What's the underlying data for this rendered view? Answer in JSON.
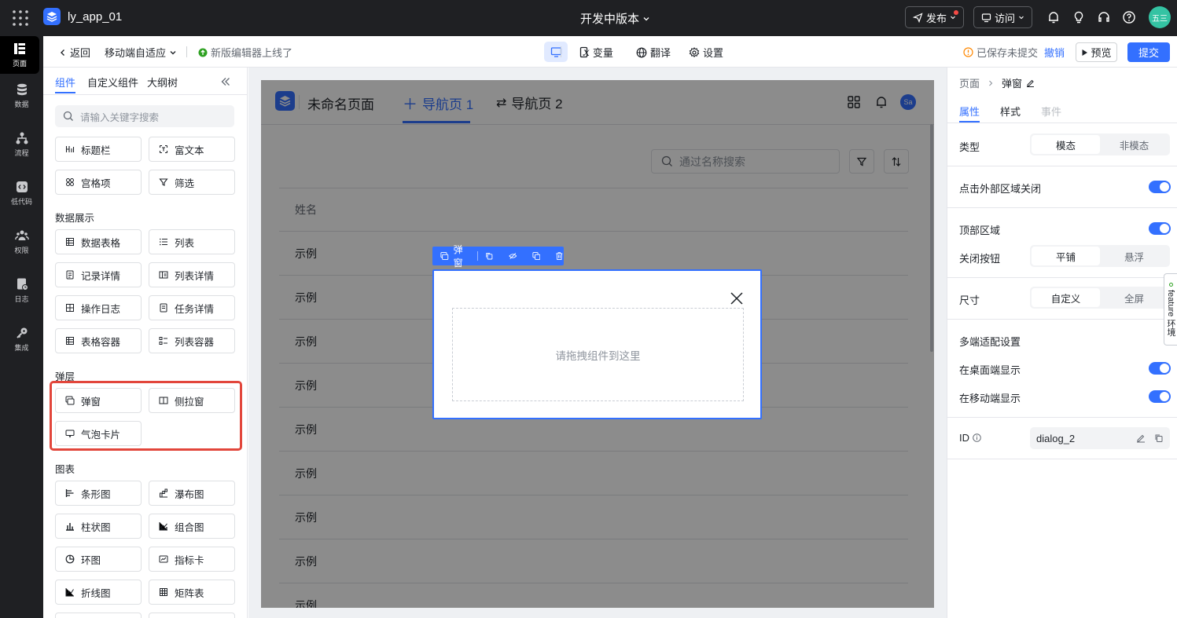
{
  "topbar": {
    "app_name": "ly_app_01",
    "center_title": "开发中版本",
    "publish_label": "发布",
    "visit_label": "访问",
    "avatar_text": "五三"
  },
  "leftnav": {
    "items": [
      {
        "label": "页面",
        "icon": "page-icon"
      },
      {
        "label": "数据",
        "icon": "database-icon"
      },
      {
        "label": "流程",
        "icon": "flow-icon"
      },
      {
        "label": "低代码",
        "icon": "code-icon"
      },
      {
        "label": "权限",
        "icon": "users-icon"
      },
      {
        "label": "日志",
        "icon": "log-icon"
      },
      {
        "label": "集成",
        "icon": "key-icon"
      }
    ]
  },
  "toolbar": {
    "back_label": "返回",
    "page_name": "移动端自适应",
    "notice": "新版编辑器上线了",
    "variables_label": "变量",
    "translate_label": "翻译",
    "settings_label": "设置",
    "save_status": "已保存未提交",
    "undo_label": "撤销",
    "preview_label": "预览",
    "submit_label": "提交"
  },
  "leftpanel": {
    "tabs": [
      "组件",
      "自定义组件",
      "大纲树"
    ],
    "search_placeholder": "请输入关键字搜索",
    "top_components": [
      "标题栏",
      "富文本",
      "宫格项",
      "筛选"
    ],
    "sections": [
      {
        "title": "数据展示",
        "items": [
          "数据表格",
          "列表",
          "记录详情",
          "列表详情",
          "操作日志",
          "任务详情",
          "表格容器",
          "列表容器"
        ]
      },
      {
        "title": "弹层",
        "items": [
          "弹窗",
          "侧拉窗",
          "气泡卡片"
        ]
      },
      {
        "title": "图表",
        "items": [
          "条形图",
          "瀑布图",
          "柱状图",
          "组合图",
          "环图",
          "指标卡",
          "折线图",
          "矩阵表"
        ]
      }
    ]
  },
  "canvas": {
    "page_title": "未命名页面",
    "tabs": [
      "导航页 1",
      "导航页 2"
    ],
    "avatar_text": "Sa",
    "search_placeholder": "通过名称搜索",
    "table_header": "姓名",
    "rows": [
      "示例",
      "示例",
      "示例",
      "示例",
      "示例",
      "示例",
      "示例",
      "示例",
      "示例"
    ],
    "dialog_toolbar_label": "弹窗",
    "dropzone_text": "请拖拽组件到这里"
  },
  "rightpanel": {
    "breadcrumb_root": "页面",
    "breadcrumb_current": "弹窗",
    "tabs": [
      "属性",
      "样式",
      "事件"
    ],
    "type_label": "类型",
    "type_options": [
      "模态",
      "非模态"
    ],
    "close_outside_label": "点击外部区域关闭",
    "top_area_label": "顶部区域",
    "close_button_label": "关闭按钮",
    "close_button_options": [
      "平铺",
      "悬浮"
    ],
    "size_label": "尺寸",
    "size_options": [
      "自定义",
      "全屏"
    ],
    "multi_device_label": "多端适配设置",
    "desktop_label": "在桌面端显示",
    "mobile_label": "在移动端显示",
    "id_label": "ID",
    "id_value": "dialog_2",
    "feature_tab": "feature 环境"
  }
}
